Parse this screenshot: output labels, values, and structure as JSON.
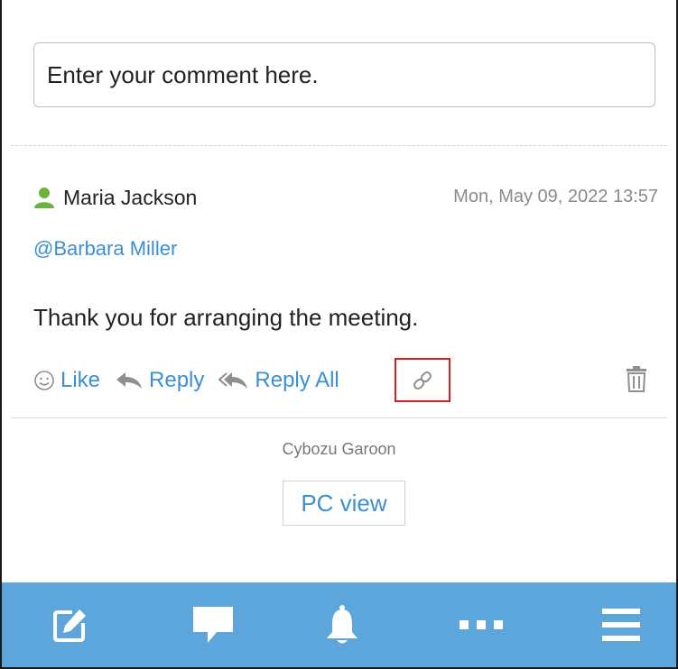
{
  "comment_box": {
    "placeholder": "Enter your comment here."
  },
  "comment": {
    "author": "Maria Jackson",
    "timestamp": "Mon, May 09, 2022 13:57",
    "mention": "@Barbara Miller",
    "body": "Thank you for arranging the meeting.",
    "actions": {
      "like": "Like",
      "reply": "Reply",
      "reply_all": "Reply All"
    }
  },
  "footer": {
    "brand": "Cybozu Garoon",
    "pc_view": "PC view"
  },
  "bottom_nav": [
    {
      "icon": "edit-icon"
    },
    {
      "icon": "comment-icon"
    },
    {
      "icon": "bell-icon"
    },
    {
      "icon": "more-icon"
    },
    {
      "icon": "menu-icon"
    }
  ],
  "colors": {
    "link_blue": "#3b8fd4",
    "nav_bar": "#5da6dc",
    "user_icon_green": "#6bb33a",
    "highlight_red": "#e01b1b"
  }
}
